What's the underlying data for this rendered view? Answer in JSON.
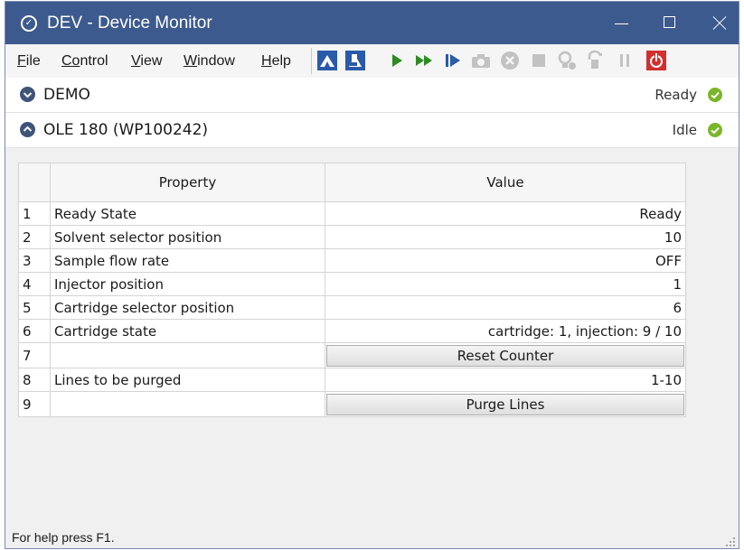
{
  "window": {
    "title": "DEV - Device Monitor"
  },
  "menu": [
    {
      "underlined": "F",
      "rest": "ile"
    },
    {
      "underlined": "Co",
      "rest": "ntrol"
    },
    {
      "underlined": "V",
      "rest": "iew"
    },
    {
      "underlined": "W",
      "rest": "indow"
    },
    {
      "underlined": "H",
      "rest": "elp"
    }
  ],
  "toolbar": {
    "icons": [
      "snapshot-icon",
      "flask-icon",
      "play-icon",
      "fast-forward-icon",
      "step-icon",
      "camera-icon",
      "cancel-icon",
      "stop-icon",
      "lamp-icon",
      "lock-icon",
      "pause-icon",
      "power-icon"
    ],
    "colors": {
      "active": "#2e8b22",
      "blue": "#2a5aa8",
      "disabled": "#c2c2c2",
      "power": "#d32f2f"
    }
  },
  "panels": [
    {
      "title": "DEMO",
      "status": "Ready",
      "expanded": false
    },
    {
      "title": "OLE 180 (WP100242)",
      "status": "Idle",
      "expanded": true
    }
  ],
  "table": {
    "headers": [
      "Property",
      "Value"
    ],
    "rows": [
      {
        "index": "1",
        "property": "Ready State",
        "value": "Ready"
      },
      {
        "index": "2",
        "property": "Solvent selector position",
        "value": "10"
      },
      {
        "index": "3",
        "property": "Sample flow rate",
        "value": "OFF"
      },
      {
        "index": "4",
        "property": "Injector position",
        "value": "1"
      },
      {
        "index": "5",
        "property": "Cartridge selector position",
        "value": "6"
      },
      {
        "index": "6",
        "property": "Cartridge state",
        "value": "cartridge: 1, injection: 9 / 10"
      },
      {
        "index": "7",
        "property": "",
        "button": "Reset Counter"
      },
      {
        "index": "8",
        "property": "Lines to be purged",
        "value": "1-10"
      },
      {
        "index": "9",
        "property": "",
        "button": "Purge Lines"
      }
    ]
  },
  "status_bar": {
    "text": "For help press F1."
  },
  "colors": {
    "titlebar": "#3c5a8e",
    "ok": "#7ab62a",
    "chevron": "#3f5478"
  }
}
